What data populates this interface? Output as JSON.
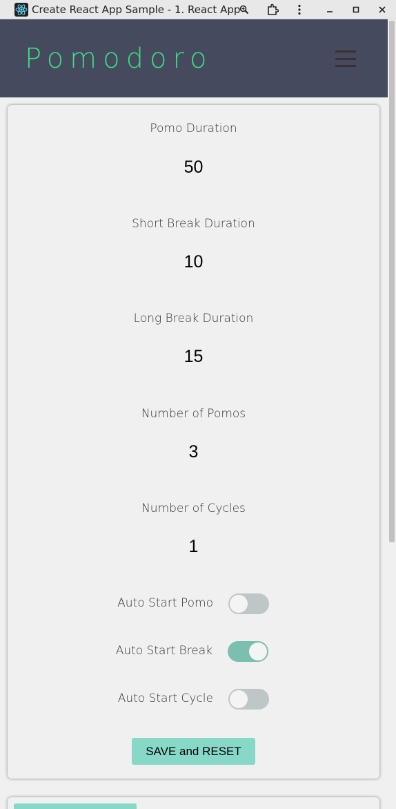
{
  "window": {
    "title": "Create React App Sample - 1. React App",
    "icons": [
      "react-logo-icon",
      "zoom-icon",
      "extensions-icon",
      "kebab-menu-icon",
      "minimize-icon",
      "maximize-icon",
      "close-icon"
    ]
  },
  "header": {
    "logo": "Pomodoro",
    "menu_icon": "hamburger-menu-icon"
  },
  "settings": {
    "fields": [
      {
        "label": "Pomo Duration",
        "value": "50"
      },
      {
        "label": "Short Break Duration",
        "value": "10"
      },
      {
        "label": "Long Break Duration",
        "value": "15"
      },
      {
        "label": "Number of Pomos",
        "value": "3"
      },
      {
        "label": "Number of Cycles",
        "value": "1"
      }
    ],
    "toggles": [
      {
        "label": "Auto Start Pomo",
        "on": false
      },
      {
        "label": "Auto Start Break",
        "on": true
      },
      {
        "label": "Auto Start Cycle",
        "on": false
      }
    ],
    "save_label": "SAVE and RESET"
  },
  "colors": {
    "header_bg": "#464a5e",
    "logo": "#3ddc84",
    "toggle_on": "#7dbfae",
    "toggle_off": "#bfc6c8",
    "button": "#88d8c8"
  }
}
